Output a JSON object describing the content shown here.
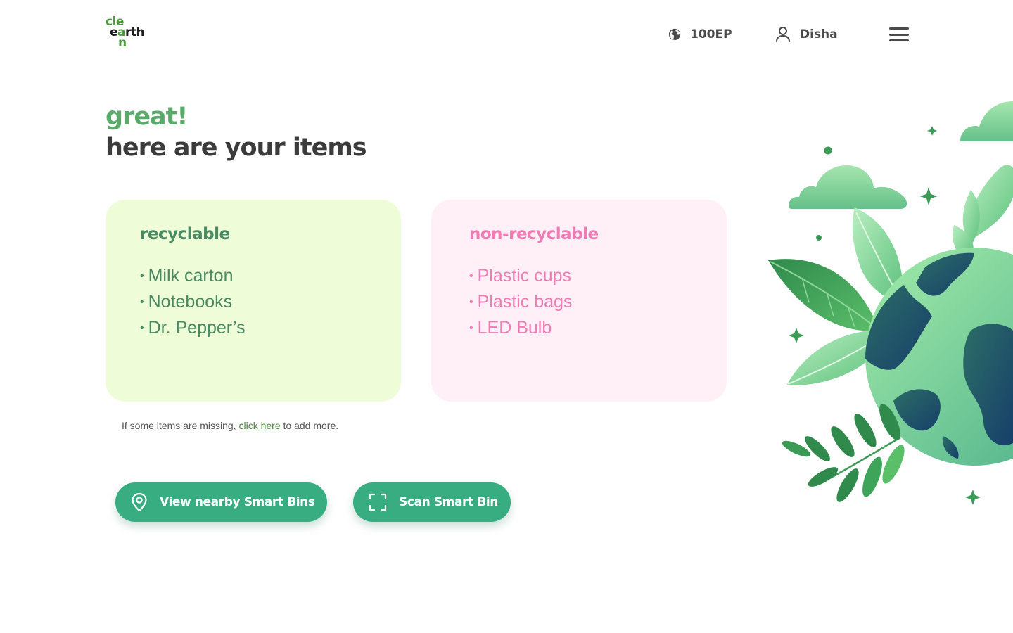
{
  "header": {
    "logo": {
      "line1": "cle",
      "line2_a": "e",
      "line2_b": "a",
      "line2_c": "rth",
      "line3": "n"
    },
    "points": {
      "icon": "globe-icon",
      "value": "100EP"
    },
    "user": {
      "icon": "user-icon",
      "name": "Disha"
    },
    "menu": {
      "icon": "hamburger-menu-icon"
    }
  },
  "hero": {
    "subtitle": "great!",
    "title": "here are your items"
  },
  "recyclable": {
    "heading": "recyclable",
    "items": [
      "Milk carton",
      "Notebooks",
      "Dr. Pepper’s"
    ],
    "color": "#4a8a62",
    "background": "#eefdd8"
  },
  "non_recyclable": {
    "heading": "non-recyclable",
    "items": [
      "Plastic cups",
      "Plastic bags",
      "LED Bulb"
    ],
    "color": "#f07cb4",
    "background": "#fff0f7"
  },
  "note": {
    "before": "If some items are missing,",
    "link": "click here",
    "after": "to add more."
  },
  "actions": {
    "nearby": {
      "icon": "location-pin-icon",
      "label": "View nearby Smart Bins"
    },
    "scan": {
      "icon": "scan-frame-icon",
      "label": "Scan Smart Bin"
    }
  },
  "colors": {
    "accent": "#38ad82",
    "brand_green": "#4a9a3c"
  }
}
